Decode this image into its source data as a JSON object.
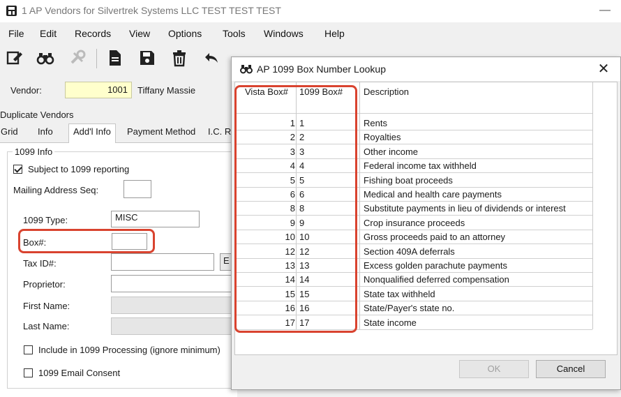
{
  "window": {
    "title": "1 AP Vendors for Silvertrek Systems LLC TEST TEST TEST",
    "minimize_glyph": "—"
  },
  "menu": [
    "File",
    "Edit",
    "Records",
    "View",
    "Options",
    "Tools",
    "Windows",
    "Help"
  ],
  "toolbar": {
    "icons": [
      "edit-icon",
      "find-icon",
      "disabled-tools-icon",
      "document-icon",
      "save-icon",
      "delete-icon",
      "undo-icon"
    ]
  },
  "vendor": {
    "label": "Vendor:",
    "number": "1001",
    "name": "Tiffany Massie"
  },
  "duplicate_tab": "Duplicate Vendors",
  "tabs": [
    "Grid",
    "Info",
    "Add'l Info",
    "Payment Method",
    "I.C. R"
  ],
  "form": {
    "group_title": "1099 Info",
    "subject_label": "Subject to 1099 reporting",
    "subject_checked": true,
    "mailing_seq_label": "Mailing Address Seq:",
    "mailing_seq_value": "",
    "type_label": "1099 Type:",
    "type_value": "MISC",
    "box_label": "Box#:",
    "box_value": "",
    "taxid_label": "Tax ID#:",
    "taxid_value": "",
    "taxid_suffix": "E",
    "proprietor_label": "Proprietor:",
    "first_name_label": "First Name:",
    "last_name_label": "Last Name:",
    "include_label": "Include in 1099 Processing (ignore minimum)",
    "include_checked": false,
    "email_consent_label": "1099 Email Consent",
    "email_consent_checked": false
  },
  "dialog": {
    "title": "AP 1099 Box Number Lookup",
    "close_glyph": "✕",
    "columns": [
      "Vista Box#",
      "1099 Box#",
      "Description"
    ],
    "rows": [
      {
        "vista": "1",
        "box": "1",
        "desc": "Rents"
      },
      {
        "vista": "2",
        "box": "2",
        "desc": "Royalties"
      },
      {
        "vista": "3",
        "box": "3",
        "desc": "Other income"
      },
      {
        "vista": "4",
        "box": "4",
        "desc": "Federal income tax withheld"
      },
      {
        "vista": "5",
        "box": "5",
        "desc": "Fishing boat proceeds"
      },
      {
        "vista": "6",
        "box": "6",
        "desc": "Medical and health care payments"
      },
      {
        "vista": "8",
        "box": "8",
        "desc": "Substitute payments in lieu of dividends or interest"
      },
      {
        "vista": "9",
        "box": "9",
        "desc": "Crop insurance proceeds"
      },
      {
        "vista": "10",
        "box": "10",
        "desc": "Gross proceeds paid to an attorney"
      },
      {
        "vista": "12",
        "box": "12",
        "desc": "Section 409A deferrals"
      },
      {
        "vista": "13",
        "box": "13",
        "desc": "Excess golden parachute payments"
      },
      {
        "vista": "14",
        "box": "14",
        "desc": "Nonqualified deferred compensation"
      },
      {
        "vista": "15",
        "box": "15",
        "desc": "State tax withheld"
      },
      {
        "vista": "16",
        "box": "16",
        "desc": "State/Payer's state no."
      },
      {
        "vista": "17",
        "box": "17",
        "desc": "State income"
      }
    ],
    "ok_label": "OK",
    "cancel_label": "Cancel",
    "highlight_color": "#d9432f"
  }
}
